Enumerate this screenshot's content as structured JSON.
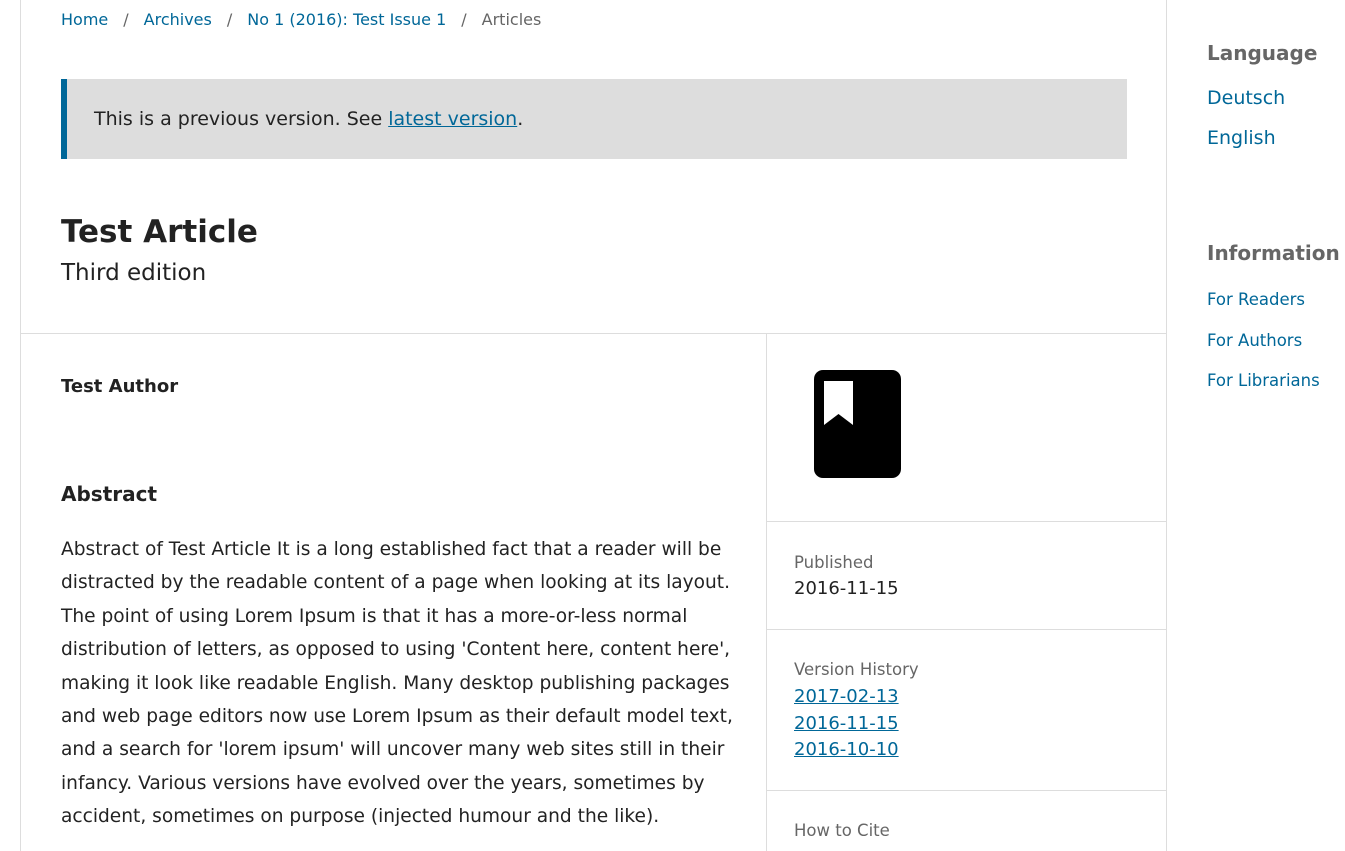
{
  "breadcrumb": {
    "items": [
      "Home",
      "Archives",
      "No 1 (2016): Test Issue 1"
    ],
    "current": "Articles",
    "separator": "/"
  },
  "notice": {
    "text": "This is a previous version. See ",
    "link": "latest version",
    "suffix": "."
  },
  "article": {
    "title": "Test Article",
    "subtitle": "Third edition",
    "author": "Test Author",
    "abstract_heading": "Abstract",
    "abstract": "Abstract of Test Article It is a long established fact that a reader will be distracted by the readable content of a page when looking at its layout. The point of using Lorem Ipsum is that it has a more-or-less normal distribution of letters, as opposed to using 'Content here, content here', making it look like readable English. Many desktop publishing packages and web page editors now use Lorem Ipsum as their default model text, and a search for 'lorem ipsum' will uncover many web sites still in their infancy. Various versions have evolved over the years, sometimes by accident, sometimes on purpose (injected humour and the like)."
  },
  "details": {
    "cover_icon": "book-bookmark-icon",
    "published_label": "Published",
    "published_value": "2016-11-15",
    "version_history_label": "Version History",
    "versions": [
      "2017-02-13",
      "2016-11-15",
      "2016-10-10"
    ],
    "how_to_cite_label": "How to Cite"
  },
  "sidebar": {
    "language_heading": "Language",
    "languages": [
      "Deutsch",
      "English"
    ],
    "information_heading": "Information",
    "information_links": [
      "For Readers",
      "For Authors",
      "For Librarians"
    ]
  },
  "colors": {
    "link": "#006798",
    "text": "#222222",
    "muted": "#666666",
    "notice_bg": "#dddddd",
    "border": "#dddddd"
  }
}
